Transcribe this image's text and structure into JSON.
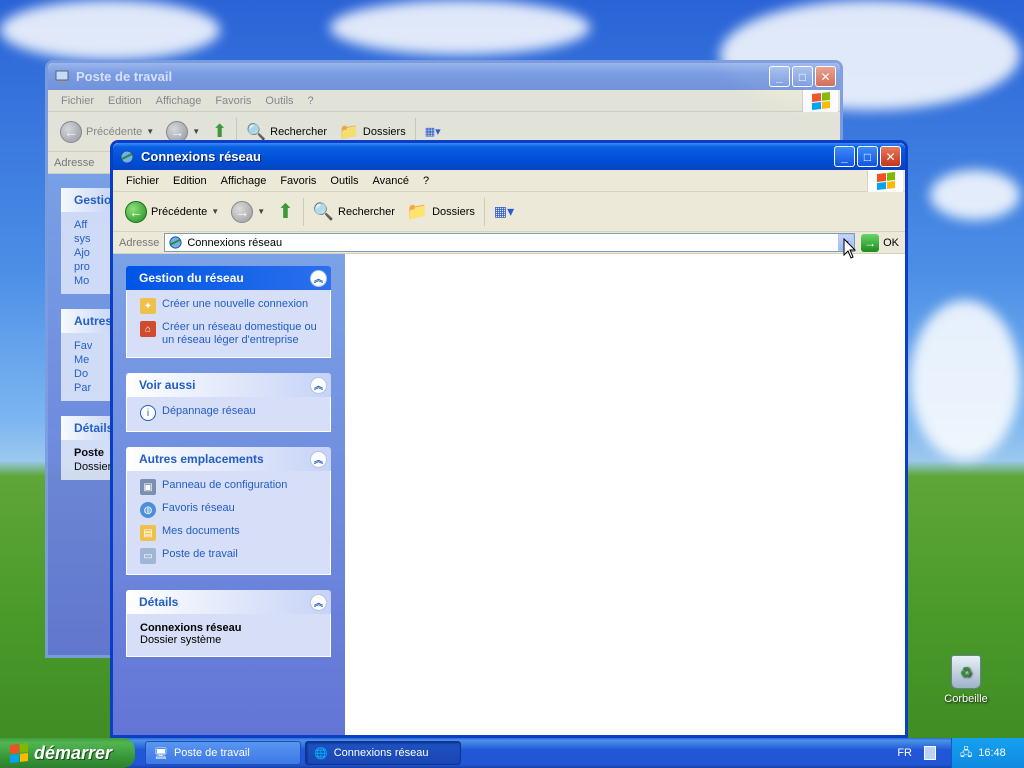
{
  "desktop": {
    "recycle_bin_label": "Corbeille"
  },
  "back_window": {
    "title": "Poste de travail",
    "menu": [
      "Fichier",
      "Edition",
      "Affichage",
      "Favoris",
      "Outils",
      "?"
    ],
    "toolbar": {
      "back": "Précédente",
      "search": "Rechercher",
      "folders": "Dossiers"
    },
    "address_label": "Adresse",
    "panes": [
      {
        "title": "Gestio",
        "items": [
          "Aff",
          "sys",
          "Ajo",
          "pro",
          "Mo"
        ]
      },
      {
        "title": "Autres",
        "items": [
          "Fav",
          "Me",
          "Do",
          "Par"
        ]
      },
      {
        "title": "Détails",
        "items": [
          "Poste",
          "Dossier"
        ]
      }
    ]
  },
  "front_window": {
    "title": "Connexions réseau",
    "menu": [
      "Fichier",
      "Edition",
      "Affichage",
      "Favoris",
      "Outils",
      "Avancé",
      "?"
    ],
    "toolbar": {
      "back": "Précédente",
      "search": "Rechercher",
      "folders": "Dossiers"
    },
    "address_label": "Adresse",
    "address_value": "Connexions réseau",
    "go_label": "OK",
    "panels": {
      "network": {
        "title": "Gestion du réseau",
        "links": [
          "Créer une nouvelle connexion",
          "Créer un réseau domestique ou un réseau léger d'entreprise"
        ]
      },
      "see_also": {
        "title": "Voir aussi",
        "links": [
          "Dépannage réseau"
        ]
      },
      "other_places": {
        "title": "Autres emplacements",
        "links": [
          "Panneau de configuration",
          "Favoris réseau",
          "Mes documents",
          "Poste de travail"
        ]
      },
      "details": {
        "title": "Détails",
        "name": "Connexions réseau",
        "type": "Dossier système"
      }
    }
  },
  "taskbar": {
    "start_label": "démarrer",
    "tasks": [
      "Poste de travail",
      "Connexions réseau"
    ],
    "language": "FR",
    "clock": "16:48"
  }
}
